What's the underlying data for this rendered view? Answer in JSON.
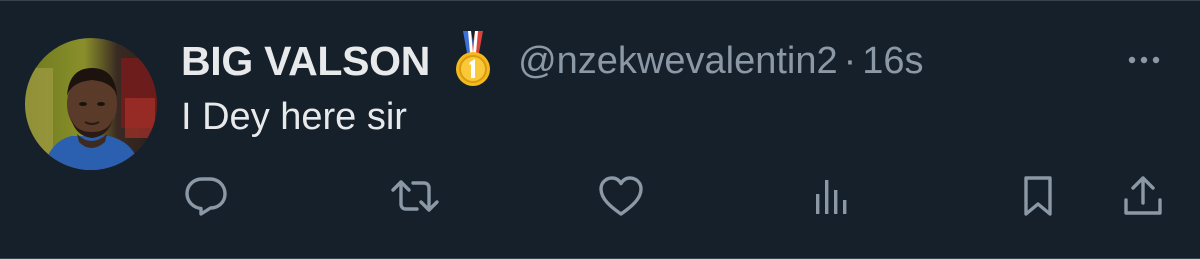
{
  "tweet": {
    "display_name": "BIG VALSON",
    "badge_icon": "gold-medal-icon",
    "handle": "@nzekwevalentin2",
    "separator": "·",
    "timestamp": "16s",
    "text": "I Dey here sir"
  },
  "actions": [
    {
      "icon": "reply-icon"
    },
    {
      "icon": "retweet-icon"
    },
    {
      "icon": "like-icon"
    },
    {
      "icon": "views-icon"
    },
    {
      "icon": "bookmark-icon"
    },
    {
      "icon": "share-icon"
    }
  ],
  "colors": {
    "background": "#15202b",
    "primary_text": "#e7e9ea",
    "secondary_text": "#8b98a5",
    "border": "#38444d",
    "medal_gold": "#f5b91c",
    "medal_ribbon_blue": "#3f6fd8",
    "medal_ribbon_red": "#d9443a"
  }
}
